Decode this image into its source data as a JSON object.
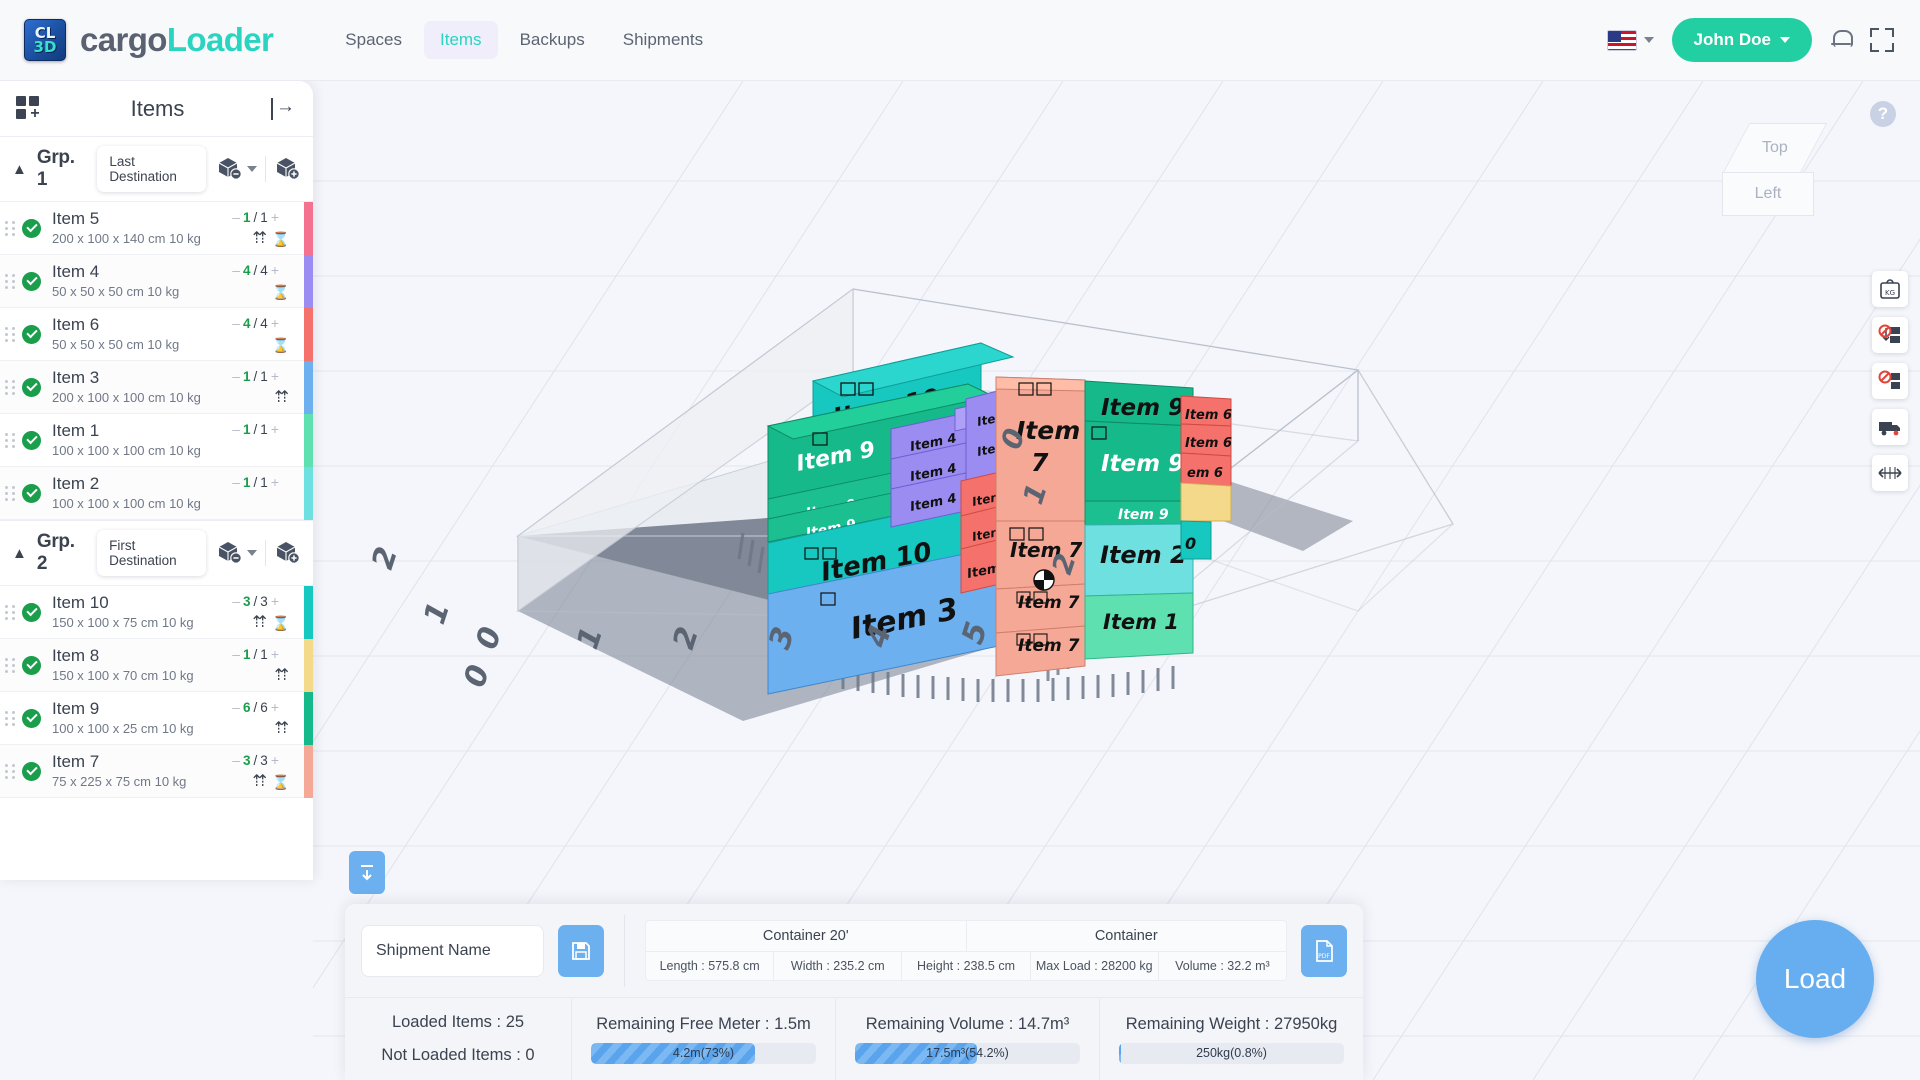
{
  "header": {
    "logo_line1": "CL",
    "logo_line2": "3D",
    "brand_first": "cargo",
    "brand_second": "Loader",
    "nav": [
      {
        "label": "Spaces",
        "active": false
      },
      {
        "label": "Items",
        "active": true
      },
      {
        "label": "Backups",
        "active": false
      },
      {
        "label": "Shipments",
        "active": false
      }
    ],
    "flag_icon": "us-flag-icon",
    "user_name": "John Doe",
    "bell_icon": "notification-bell-icon",
    "expand_icon": "fullscreen-expand-icon"
  },
  "sidebar": {
    "title": "Items",
    "add_icon": "grid-add-icon",
    "collapse_icon": "collapse-panel-icon",
    "groups": [
      {
        "name": "Grp. 1",
        "destination": "Last Destination",
        "remove_icon": "cube-remove-icon",
        "add_icon": "cube-add-icon",
        "items": [
          {
            "name": "Item 5",
            "dims": "200 x 100 x 140 cm 10 kg",
            "qty_current": "1",
            "qty_total": "1",
            "color": "#f4728f",
            "icons": [
              "this-side-up-icon",
              "fragile-icon"
            ]
          },
          {
            "name": "Item 4",
            "dims": "50 x 50 x 50 cm 10 kg",
            "qty_current": "4",
            "qty_total": "4",
            "color": "#9b8cf2",
            "icons": [
              "fragile-icon"
            ]
          },
          {
            "name": "Item 6",
            "dims": "50 x 50 x 50 cm 10 kg",
            "qty_current": "4",
            "qty_total": "4",
            "color": "#f4726b",
            "icons": [
              "fragile-icon"
            ]
          },
          {
            "name": "Item 3",
            "dims": "200 x 100 x 100 cm 10 kg",
            "qty_current": "1",
            "qty_total": "1",
            "color": "#6cb0f0",
            "icons": [
              "this-side-up-icon"
            ]
          },
          {
            "name": "Item 1",
            "dims": "100 x 100 x 100 cm 10 kg",
            "qty_current": "1",
            "qty_total": "1",
            "color": "#5fe0b0",
            "icons": []
          },
          {
            "name": "Item 2",
            "dims": "100 x 100 x 100 cm 10 kg",
            "qty_current": "1",
            "qty_total": "1",
            "color": "#6ee0e0",
            "icons": []
          }
        ]
      },
      {
        "name": "Grp. 2",
        "destination": "First Destination",
        "remove_icon": "cube-remove-icon",
        "add_icon": "cube-add-icon",
        "items": [
          {
            "name": "Item 10",
            "dims": "150 x 100 x 75 cm 10 kg",
            "qty_current": "3",
            "qty_total": "3",
            "color": "#17c8c0",
            "icons": [
              "this-side-up-icon",
              "fragile-icon"
            ]
          },
          {
            "name": "Item 8",
            "dims": "150 x 100 x 70 cm 10 kg",
            "qty_current": "1",
            "qty_total": "1",
            "color": "#f5d98a",
            "icons": [
              "this-side-up-icon"
            ]
          },
          {
            "name": "Item 9",
            "dims": "100 x 100 x 25 cm 10 kg",
            "qty_current": "6",
            "qty_total": "6",
            "color": "#16b98a",
            "icons": [
              "this-side-up-icon"
            ]
          },
          {
            "name": "Item 7",
            "dims": "75 x 225 x 75 cm 10 kg",
            "qty_current": "3",
            "qty_total": "3",
            "color": "#f5a896",
            "icons": [
              "this-side-up-icon",
              "fragile-icon"
            ]
          }
        ]
      }
    ]
  },
  "viewport": {
    "help_icon": "help-question-icon",
    "viewcube": {
      "top_label": "Top",
      "left_label": "Left"
    },
    "tools": [
      {
        "name": "weight-kg-tool",
        "label": "KG"
      },
      {
        "name": "no-stack-down-tool",
        "label": ""
      },
      {
        "name": "no-side-load-tool",
        "label": ""
      },
      {
        "name": "truck-view-tool",
        "label": ""
      },
      {
        "name": "measure-tool",
        "label": ""
      }
    ],
    "drop_icon": "drop-down-arrow-icon",
    "load_button": "Load",
    "axis_labels_bottom": [
      "0",
      "1",
      "2",
      "3",
      "4",
      "5"
    ],
    "axis_labels_left": [
      "2",
      "1",
      "0",
      "0"
    ],
    "axis_labels_right": [
      "0",
      "1",
      "2"
    ],
    "boxes": [
      {
        "label": "Item 10",
        "color": "#17c8c0"
      },
      {
        "label": "Item 9",
        "color": "#16b98a"
      },
      {
        "label": "Item 4",
        "color": "#9b8cf2"
      },
      {
        "label": "Item 7",
        "color": "#f5a896"
      },
      {
        "label": "Item 6",
        "color": "#f4726b"
      },
      {
        "label": "Item 3",
        "color": "#6cb0f0"
      },
      {
        "label": "Item 2",
        "color": "#6ee0e0"
      },
      {
        "label": "Item 1",
        "color": "#5fe0b0"
      },
      {
        "label": "Item 8",
        "color": "#f5d98a"
      }
    ]
  },
  "bottom": {
    "shipment_placeholder": "Shipment Name",
    "shipment_value": "",
    "save_icon": "save-disk-icon",
    "pdf_icon": "pdf-export-icon",
    "pdf_label": "PDF",
    "container_headers": [
      "Container 20'",
      "Container"
    ],
    "container_specs": [
      "Length : 575.8 cm",
      "Width : 235.2 cm",
      "Height : 238.5 cm",
      "Max Load : 28200 kg",
      "Volume : 32.2 m³"
    ],
    "loaded_items": "Loaded Items : 25",
    "not_loaded_items": "Not Loaded Items : 0",
    "stats": [
      {
        "label": "Remaining Free Meter : 1.5m",
        "bar_text": "4.2m(73%)",
        "percent": 73
      },
      {
        "label": "Remaining Volume : 14.7m³",
        "bar_text": "17.5m³(54.2%)",
        "percent": 54.2
      },
      {
        "label": "Remaining Weight : 27950kg",
        "bar_text": "250kg(0.8%)",
        "percent": 0.8
      }
    ]
  }
}
